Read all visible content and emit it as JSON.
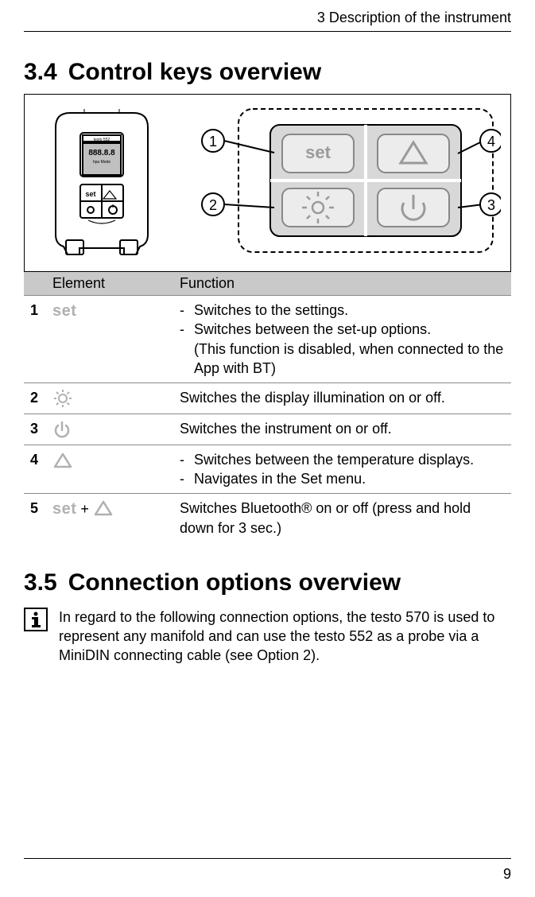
{
  "header": {
    "chapter": "3 Description of the instrument"
  },
  "sections": {
    "s34": {
      "num": "3.4",
      "title": "Control keys overview"
    },
    "s35": {
      "num": "3.5",
      "title": "Connection options overview"
    }
  },
  "figure": {
    "callouts": {
      "c1": "1",
      "c2": "2",
      "c3": "3",
      "c4": "4"
    }
  },
  "table": {
    "head": {
      "blank": "",
      "element": "Element",
      "function": "Function"
    },
    "rows": [
      {
        "num": "1",
        "element_label": "set",
        "func_items": [
          "Switches to the settings.",
          "Switches between the set-up options."
        ],
        "func_note": "(This function is disabled, when connected to the App with BT)"
      },
      {
        "num": "2",
        "element_label": "brightness-icon",
        "func_text": "Switches the display illumination on or off."
      },
      {
        "num": "3",
        "element_label": "power-icon",
        "func_text": "Switches the instrument on or off."
      },
      {
        "num": "4",
        "element_label": "triangle-icon",
        "func_items": [
          "Switches between the temperature displays.",
          "Navigates in the Set menu."
        ]
      },
      {
        "num": "5",
        "element_label": "set-plus-triangle",
        "element_set": "set",
        "element_plus": " + ",
        "func_text": "Switches Bluetooth® on or off (press and hold down for 3 sec.)"
      }
    ]
  },
  "info": {
    "text": "In regard to the following connection options, the testo 570 is used to represent any manifold and can use the testo 552 as a probe via a MiniDIN connecting cable (see Option 2)."
  },
  "pageNumber": "9"
}
